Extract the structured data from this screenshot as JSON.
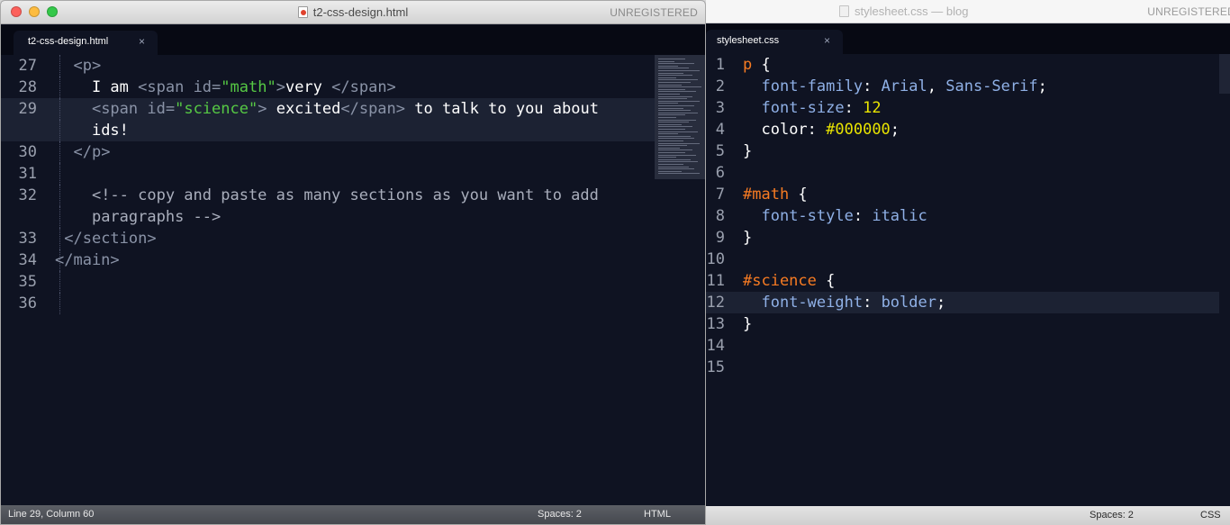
{
  "left_window": {
    "title": "t2-css-design.html",
    "unregistered": "UNREGISTERED",
    "tab_label": "t2-css-design.html",
    "tab_close": "×",
    "status": {
      "position": "Line 29, Column 60",
      "spaces": "Spaces: 2",
      "syntax": "HTML"
    },
    "gutter": [
      "27",
      "28",
      "29",
      "",
      "30",
      "31",
      "32",
      "",
      "33",
      "34",
      "35",
      "36"
    ],
    "lines": [
      {
        "indent": "  ",
        "parts": [
          [
            "tag",
            "<p>"
          ]
        ]
      },
      {
        "indent": "    ",
        "parts": [
          [
            "txt",
            "I am "
          ],
          [
            "tag",
            "<span "
          ],
          [
            "attr",
            "id="
          ],
          [
            "str",
            "\"math\""
          ],
          [
            "tag",
            ">"
          ],
          [
            "txt",
            "very "
          ],
          [
            "tag",
            "</span>"
          ]
        ]
      },
      {
        "indent": "    ",
        "parts": [
          [
            "tag",
            "<span "
          ],
          [
            "attr",
            "id="
          ],
          [
            "str",
            "\"science\""
          ],
          [
            "tag",
            ">"
          ],
          [
            "txt",
            " excited"
          ],
          [
            "tag",
            "</span>"
          ],
          [
            "txt",
            " to talk to you about"
          ]
        ]
      },
      {
        "indent": "    ",
        "parts": [
          [
            "txt",
            "ids!"
          ]
        ]
      },
      {
        "indent": "  ",
        "parts": [
          [
            "tag",
            "</p>"
          ]
        ]
      },
      {
        "indent": "",
        "parts": []
      },
      {
        "indent": "    ",
        "parts": [
          [
            "cmt",
            "<!-- copy and paste as many sections as you want to add"
          ]
        ]
      },
      {
        "indent": "    ",
        "parts": [
          [
            "cmt",
            "paragraphs -->"
          ]
        ]
      },
      {
        "indent": " ",
        "parts": [
          [
            "tag",
            "</section>"
          ]
        ]
      },
      {
        "indent": "",
        "parts": [
          [
            "tag",
            "</main>"
          ]
        ]
      },
      {
        "indent": "",
        "parts": []
      },
      {
        "indent": "",
        "parts": []
      }
    ]
  },
  "right_window": {
    "title": "stylesheet.css — blog",
    "unregistered": "UNREGISTERED",
    "tab_label": "stylesheet.css",
    "tab_close": "×",
    "status": {
      "spaces": "Spaces: 2",
      "syntax": "CSS"
    },
    "gutter": [
      "1",
      "2",
      "3",
      "4",
      "5",
      "6",
      "7",
      "8",
      "9",
      "10",
      "11",
      "12",
      "13",
      "14",
      "15"
    ],
    "lines": [
      {
        "indent": "",
        "parts": [
          [
            "sel",
            "p"
          ],
          [
            "punc",
            " {"
          ]
        ]
      },
      {
        "indent": "  ",
        "parts": [
          [
            "prop",
            "font-family"
          ],
          [
            "punc",
            ": "
          ],
          [
            "val",
            "Arial"
          ],
          [
            "punc",
            ", "
          ],
          [
            "val",
            "Sans-Serif"
          ],
          [
            "punc",
            ";"
          ]
        ]
      },
      {
        "indent": "  ",
        "parts": [
          [
            "prop",
            "font-size"
          ],
          [
            "punc",
            ": "
          ],
          [
            "num",
            "12"
          ]
        ]
      },
      {
        "indent": "  ",
        "parts": [
          [
            "punc",
            "color: "
          ],
          [
            "num",
            "#000000"
          ],
          [
            "punc",
            ";"
          ]
        ]
      },
      {
        "indent": "",
        "parts": [
          [
            "punc",
            "}"
          ]
        ]
      },
      {
        "indent": "",
        "parts": []
      },
      {
        "indent": "",
        "parts": [
          [
            "sel",
            "#math"
          ],
          [
            "punc",
            " {"
          ]
        ]
      },
      {
        "indent": "  ",
        "parts": [
          [
            "prop",
            "font-style"
          ],
          [
            "punc",
            ": "
          ],
          [
            "val",
            "italic"
          ]
        ]
      },
      {
        "indent": "",
        "parts": [
          [
            "punc",
            "}"
          ]
        ]
      },
      {
        "indent": "",
        "parts": []
      },
      {
        "indent": "",
        "parts": [
          [
            "sel",
            "#science"
          ],
          [
            "punc",
            " {"
          ]
        ]
      },
      {
        "indent": "  ",
        "parts": [
          [
            "prop",
            "font-weight"
          ],
          [
            "punc",
            ": "
          ],
          [
            "val",
            "bolder"
          ],
          [
            "punc",
            ";"
          ]
        ]
      },
      {
        "indent": "",
        "parts": [
          [
            "punc",
            "}"
          ]
        ]
      },
      {
        "indent": "",
        "parts": []
      },
      {
        "indent": "",
        "parts": []
      }
    ]
  }
}
